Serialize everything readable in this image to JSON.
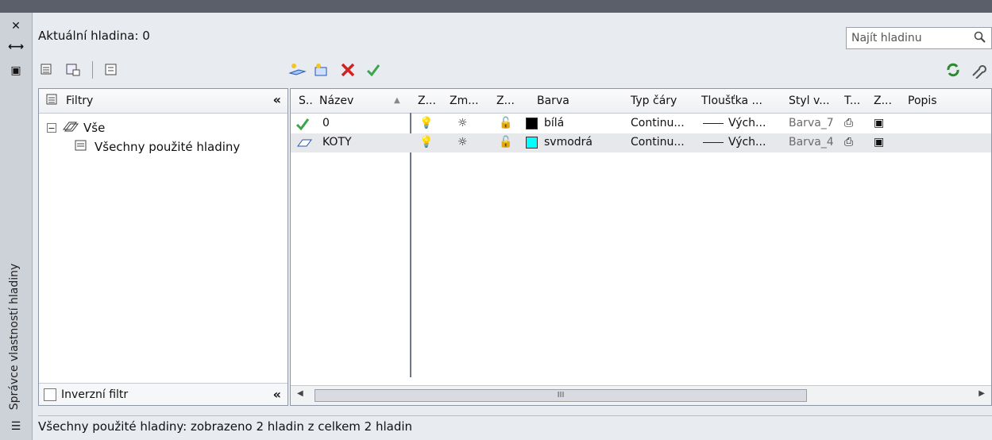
{
  "app": {
    "vertical_title": "Správce vlastností hladiny",
    "current_layer_label": "Aktuální hladina: 0",
    "search_placeholder": "Najít hladinu",
    "status_text": "Všechny použité hladiny: zobrazeno 2 hladin z celkem 2 hladin"
  },
  "filters": {
    "title": "Filtry",
    "tree": [
      {
        "label": "Vše",
        "level": 0
      },
      {
        "label": "Všechny použité hladiny",
        "level": 1
      }
    ],
    "inverse_label": "Inverzní filtr"
  },
  "table": {
    "columns": [
      "S..",
      "Název",
      "Z...",
      "Zm...",
      "Z...",
      "Barva",
      "Typ čáry",
      "Tloušťka ...",
      "Styl v...",
      "T...",
      "Z...",
      "Popis"
    ],
    "rows": [
      {
        "name": "0",
        "color_name": "bílá",
        "color_hex": "#000000",
        "linetype": "Continu...",
        "lineweight": "Vých...",
        "plotstyle": "Barva_7"
      },
      {
        "name": "KOTY",
        "color_name": "svmodrá",
        "color_hex": "#00ffff",
        "linetype": "Continu...",
        "lineweight": "Vých...",
        "plotstyle": "Barva_4"
      }
    ],
    "scrollbar_text": "III"
  },
  "colors": {
    "accent_check": "#3aa64a",
    "delete_x": "#d22424"
  }
}
